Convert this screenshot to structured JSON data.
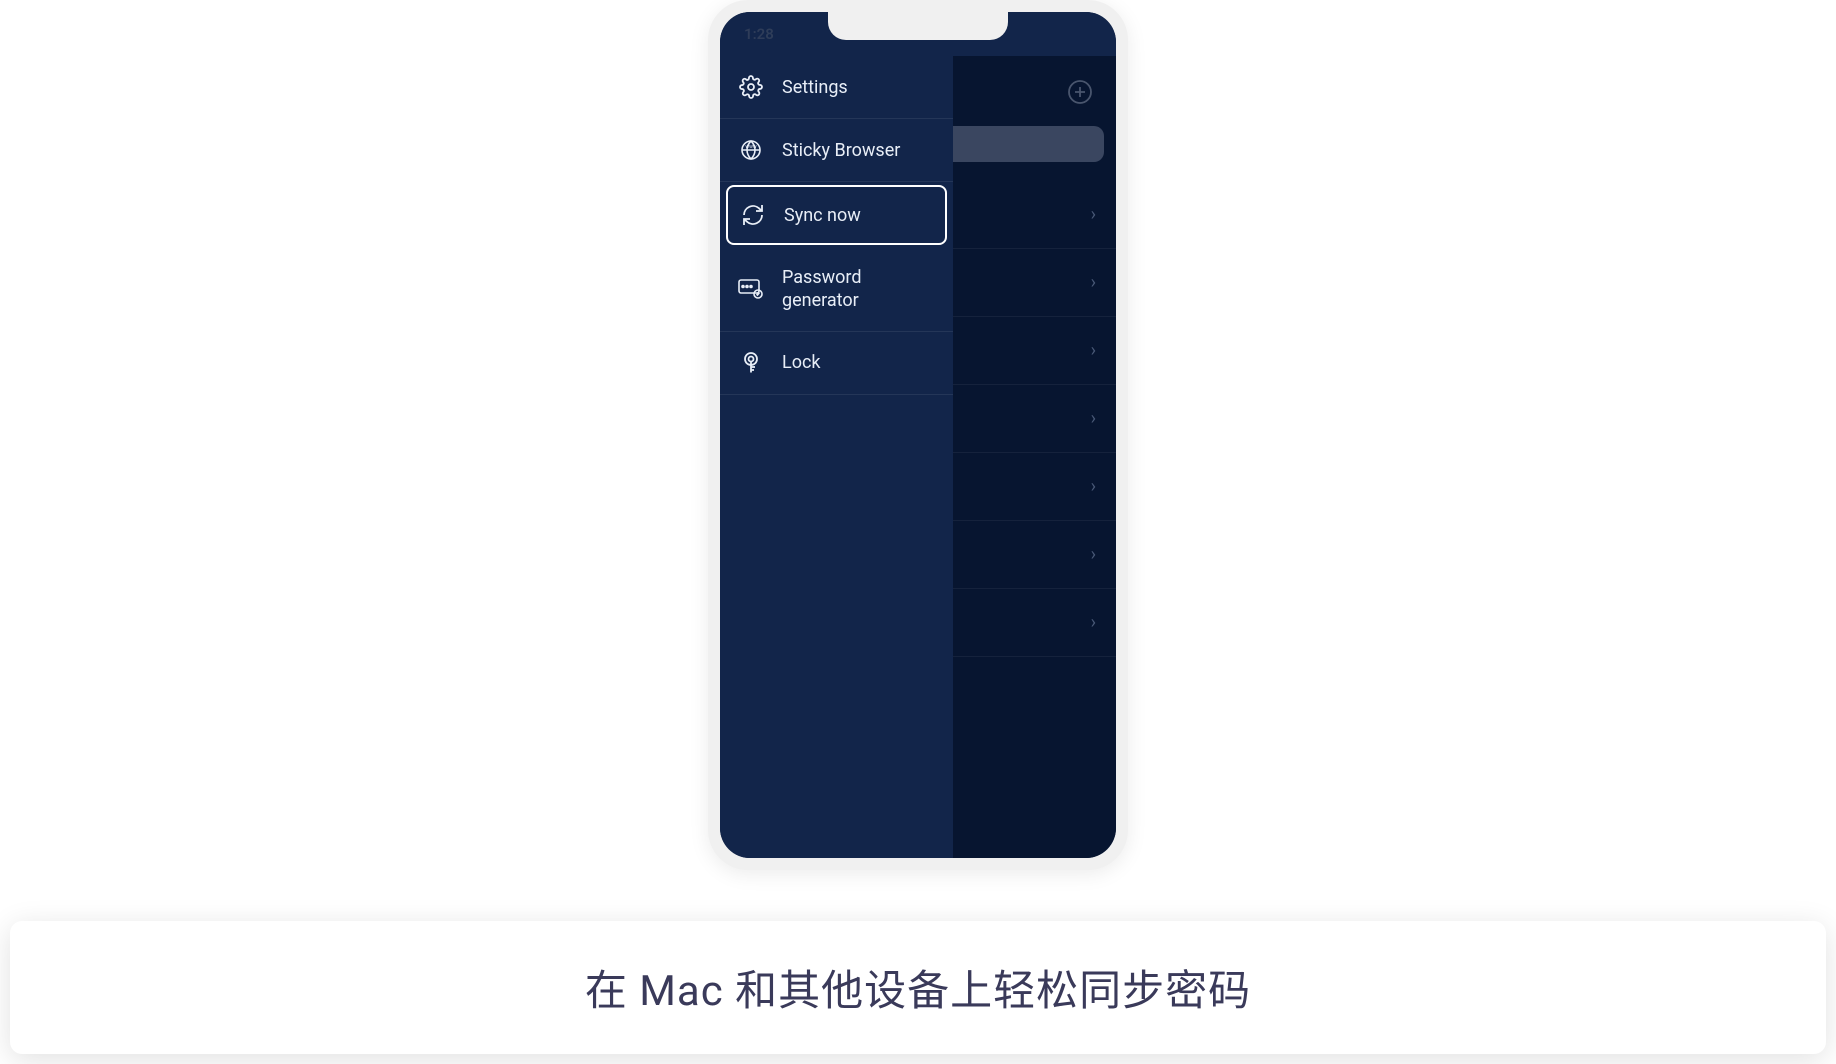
{
  "status_bar": {
    "time": "1:28"
  },
  "sidebar": {
    "items": [
      {
        "label": "Settings",
        "icon": "gear"
      },
      {
        "label": "Sticky Browser",
        "icon": "globe"
      },
      {
        "label": "Sync now",
        "icon": "sync",
        "highlighted": true
      },
      {
        "label": "Password generator",
        "icon": "password"
      },
      {
        "label": "Lock",
        "icon": "lock"
      }
    ]
  },
  "main": {
    "add_icon": "plus-circle",
    "list_rows_count": 7
  },
  "caption": "在 Mac 和其他设备上轻松同步密码",
  "colors": {
    "phone_bezel": "#f0f0f0",
    "screen_dark": "#0a1e3f",
    "sidebar_bg": "#12254a",
    "main_bg": "#071530",
    "text_light": "#e8eef7",
    "caption_text": "#3a3a5a"
  }
}
